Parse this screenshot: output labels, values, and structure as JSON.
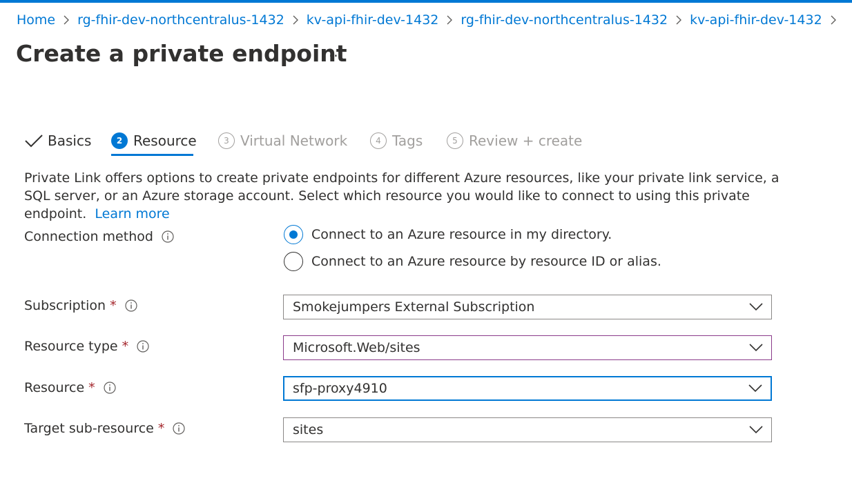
{
  "breadcrumb": [
    "Home",
    "rg-fhir-dev-northcentralus-1432",
    "kv-api-fhir-dev-1432",
    "rg-fhir-dev-northcentralus-1432",
    "kv-api-fhir-dev-1432"
  ],
  "page": {
    "title": "Create a private endpoint",
    "more": "···"
  },
  "tabs": [
    {
      "label": "Basics",
      "state": "completed"
    },
    {
      "num": "2",
      "label": "Resource",
      "state": "active"
    },
    {
      "num": "3",
      "label": "Virtual Network",
      "state": "disabled"
    },
    {
      "num": "4",
      "label": "Tags",
      "state": "disabled"
    },
    {
      "num": "5",
      "label": "Review + create",
      "state": "disabled"
    }
  ],
  "description": {
    "text": "Private Link offers options to create private endpoints for different Azure resources, like your private link service, a SQL server, or an Azure storage account. Select which resource you would like to connect to using this private endpoint.",
    "link": "Learn more"
  },
  "form": {
    "connection_method": {
      "label": "Connection method",
      "options": [
        "Connect to an Azure resource in my directory.",
        "Connect to an Azure resource by resource ID or alias."
      ],
      "selected_index": 0
    },
    "subscription": {
      "label": "Subscription",
      "required": "*",
      "value": "Smokejumpers External Subscription"
    },
    "resource_type": {
      "label": "Resource type",
      "required": "*",
      "value": "Microsoft.Web/sites"
    },
    "resource": {
      "label": "Resource",
      "required": "*",
      "value": "sfp-proxy4910"
    },
    "target_sub_resource": {
      "label": "Target sub-resource",
      "required": "*",
      "value": "sites"
    }
  },
  "colors": {
    "accent": "#0078d4",
    "required": "#a4262c",
    "disabled": "#a19f9d",
    "text": "#323130"
  }
}
